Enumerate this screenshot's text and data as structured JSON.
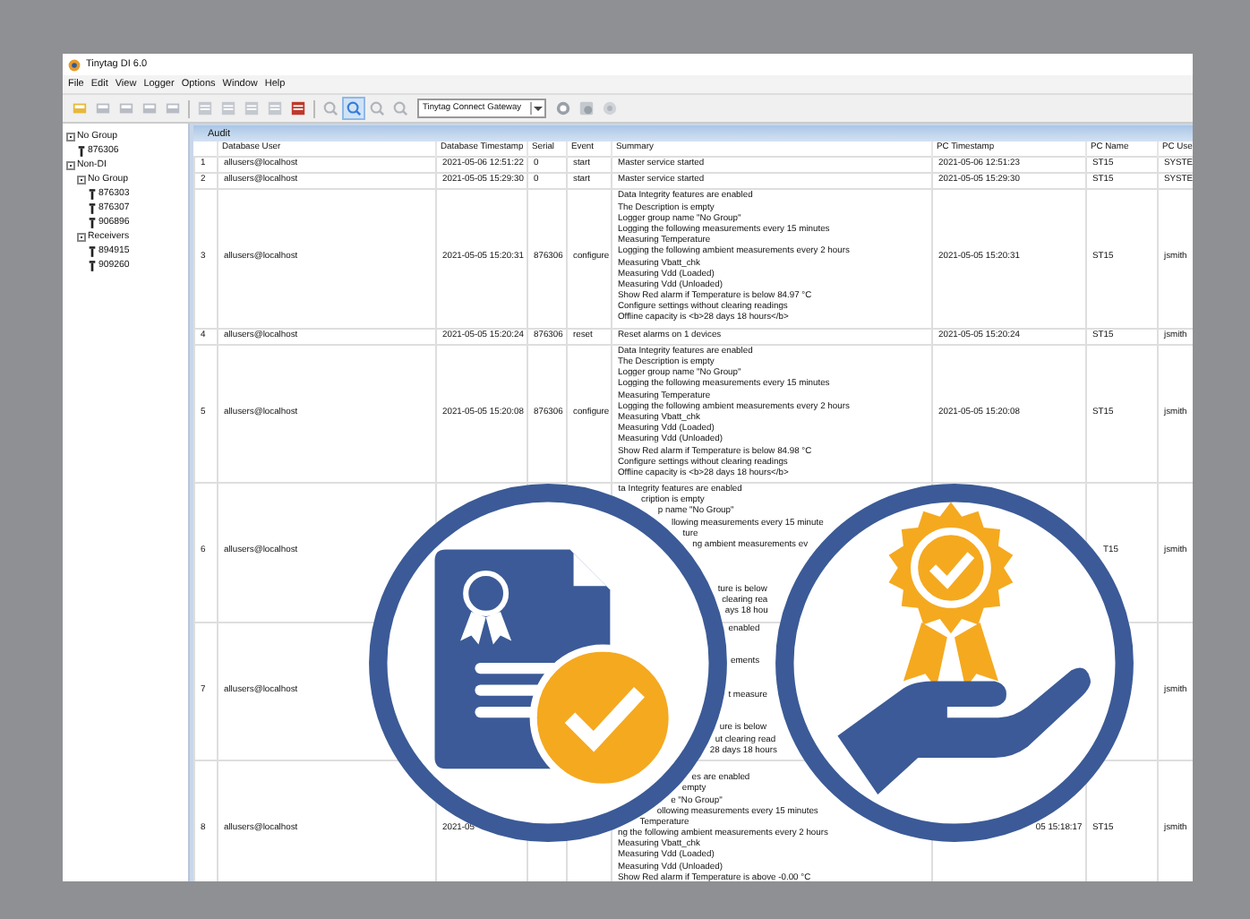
{
  "window": {
    "title": "Tinytag DI 6.0"
  },
  "menu": [
    "File",
    "Edit",
    "View",
    "Logger",
    "Options",
    "Window",
    "Help"
  ],
  "toolbar": {
    "gateway_select": "Tinytag Connect Gateway"
  },
  "tree": [
    {
      "label": "No Group",
      "expanded": true,
      "children": [
        {
          "label": "876306"
        }
      ]
    },
    {
      "label": "Non-DI",
      "expanded": true,
      "children": [
        {
          "label": "No Group",
          "expanded": true,
          "children": [
            {
              "label": "876303"
            },
            {
              "label": "876307"
            },
            {
              "label": "906896"
            }
          ]
        },
        {
          "label": "Receivers",
          "expanded": true,
          "children": [
            {
              "label": "894915"
            },
            {
              "label": "909260"
            }
          ]
        }
      ]
    }
  ],
  "audit": {
    "title": "Audit",
    "columns": [
      "",
      "Database User",
      "Database Timestamp",
      "Serial",
      "Event",
      "Summary",
      "PC Timestamp",
      "PC Name",
      "PC Use"
    ],
    "rows": [
      {
        "index": "1",
        "user": "allusers@localhost",
        "db_timestamp": "2021-05-06 12:51:22",
        "serial": "0",
        "event": "start",
        "summary": [
          [
            "Master service started"
          ]
        ],
        "pc_timestamp": "2021-05-06 12:51:23",
        "pc_name": "ST15",
        "pc_user": "SYSTE"
      },
      {
        "index": "2",
        "user": "allusers@localhost",
        "db_timestamp": "2021-05-05 15:29:30",
        "serial": "0",
        "event": "start",
        "summary": [
          [
            "Master service started"
          ]
        ],
        "pc_timestamp": "2021-05-05 15:29:30",
        "pc_name": "ST15",
        "pc_user": "SYSTE"
      },
      {
        "index": "3",
        "user": "allusers@localhost",
        "db_timestamp": "2021-05-05 15:20:31",
        "serial": "876306",
        "event": "configure",
        "summary": [
          [
            "Data Integrity features are enabled",
            "The Description is empty",
            "Logger group name \"No Group\"",
            "Logging the following measurements every 15 minutes",
            "Measuring Temperature",
            "Logging the following ambient measurements every 2 hours",
            "Measuring Vbatt_chk",
            "Measuring Vdd (Loaded)",
            "Measuring Vdd (Unloaded)",
            "Show Red alarm if Temperature is below 84.97 °C",
            "Configure settings without clearing readings",
            "Offline capacity is <b>28 days 18 hours</b>"
          ]
        ],
        "pc_timestamp": "2021-05-05 15:20:31",
        "pc_name": "ST15",
        "pc_user": "jsmith"
      },
      {
        "index": "4",
        "user": "allusers@localhost",
        "db_timestamp": "2021-05-05 15:20:24",
        "serial": "876306",
        "event": "reset",
        "summary": [
          [
            "Reset alarms on 1 devices"
          ]
        ],
        "pc_timestamp": "2021-05-05 15:20:24",
        "pc_name": "ST15",
        "pc_user": "jsmith"
      },
      {
        "index": "5",
        "user": "allusers@localhost",
        "db_timestamp": "2021-05-05 15:20:08",
        "serial": "876306",
        "event": "configure",
        "summary": [
          [
            "Data Integrity features are enabled",
            "The Description is empty",
            "Logger group name \"No Group\"",
            "Logging the following measurements every 15 minutes",
            "Measuring Temperature",
            "Logging the following ambient measurements every 2 hours",
            "Measuring Vbatt_chk",
            "Measuring Vdd (Loaded)",
            "Measuring Vdd (Unloaded)",
            "Show Red alarm if Temperature is below 84.98 °C",
            "Configure settings without clearing readings",
            "Offline capacity is <b>28 days 18 hours</b>"
          ]
        ],
        "pc_timestamp": "2021-05-05 15:20:08",
        "pc_name": "ST15",
        "pc_user": "jsmith"
      },
      {
        "index": "6",
        "user": "allusers@localhost",
        "summary": [
          [
            "ta Integrity features are enabled",
            "cription is empty",
            "p name \"No Group\"",
            "llowing measurements every 15 minute",
            "ture",
            "ng ambient measurements ev"
          ],
          [
            "ture is below",
            "clearing rea",
            "ays 18 hou"
          ]
        ],
        "pc_name": "T15",
        "pc_user": "jsmith"
      },
      {
        "index": "7",
        "user": "allusers@localhost",
        "summary": [
          [
            "enabled"
          ],
          [
            "ements"
          ],
          [
            "t measure"
          ],
          [
            "ure is below",
            "ut clearing read",
            "28 days 18 hours"
          ]
        ],
        "pc_user": "jsmith"
      },
      {
        "index": "8",
        "user": "allusers@localhost",
        "db_timestamp": "2021-05",
        "summary": [
          [
            "es are enabled",
            "empty",
            "e \"No Group\"",
            "ollowing measurements every 15 minutes",
            "Temperature",
            "ng the following ambient measurements every 2 hours",
            "Measuring Vbatt_chk",
            "Measuring Vdd (Loaded)",
            "Measuring Vdd (Unloaded)",
            "Show Red alarm if Temperature is above -0.00 °C"
          ]
        ],
        "pc_timestamp": "05 15:18:17",
        "pc_name": "ST15",
        "pc_user": "jsmith"
      }
    ]
  }
}
